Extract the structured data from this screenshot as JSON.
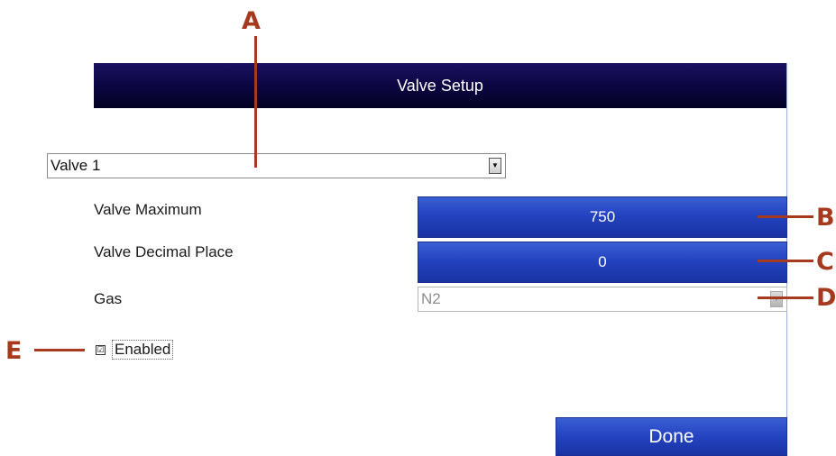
{
  "window": {
    "title": "Valve Setup"
  },
  "valve_select": {
    "value": "Valve 1"
  },
  "fields": {
    "valve_maximum": {
      "label": "Valve Maximum",
      "value": "750"
    },
    "valve_decimal_place": {
      "label": "Valve Decimal Place",
      "value": "0"
    },
    "gas": {
      "label": "Gas",
      "value": "N2"
    }
  },
  "enabled": {
    "label": "Enabled",
    "checked": true,
    "check_glyph": "☑"
  },
  "done_label": "Done",
  "callouts": {
    "a": "A",
    "b": "B",
    "c": "C",
    "d": "D",
    "e": "E"
  },
  "colors": {
    "title_bar": "#0b0640",
    "button": "#2443c0",
    "callout": "#a63a1e"
  }
}
